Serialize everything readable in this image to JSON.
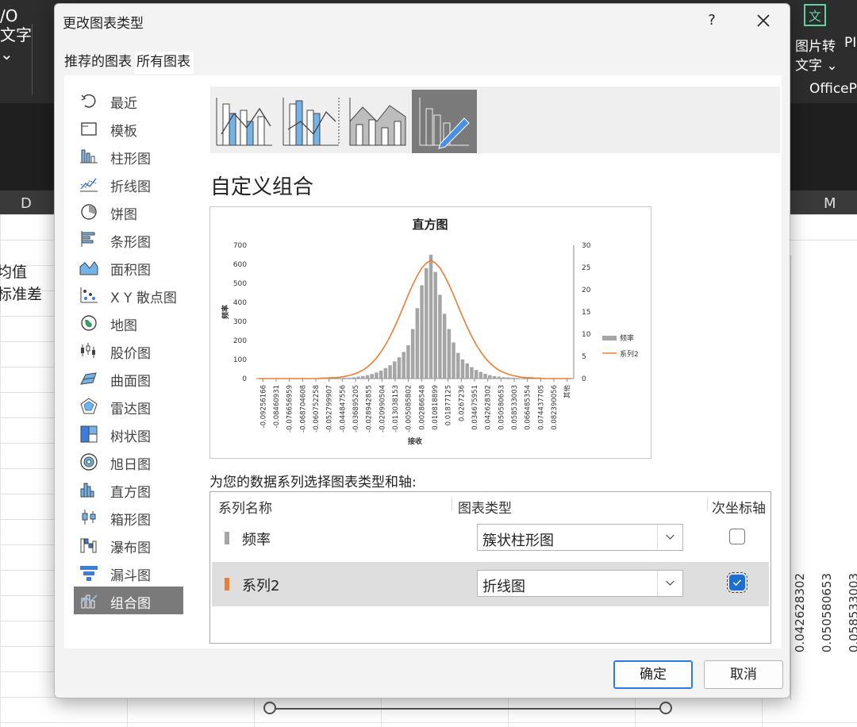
{
  "background": {
    "ribbon_left_text": "/O\n文字\n⌄",
    "ribbon_button1": "图片转",
    "ribbon_button1b": "文字 ⌄",
    "ribbon_button2": "PI",
    "ribbon_group": "OfficeP",
    "column_left": "D",
    "column_right": "M",
    "cell_text_1": "均值",
    "cell_text_2": "标准差",
    "bg_axis_labels": [
      "0.042628302",
      "0.050580653",
      "0.058533003"
    ]
  },
  "dialog": {
    "title": "更改图表类型",
    "help": "?",
    "tabs": [
      "推荐的图表",
      "所有图表"
    ],
    "active_tab": 1,
    "sidebar": [
      {
        "label": "最近",
        "icon": "recent-icon"
      },
      {
        "label": "模板",
        "icon": "template-icon"
      },
      {
        "label": "柱形图",
        "icon": "column-chart-icon"
      },
      {
        "label": "折线图",
        "icon": "line-chart-icon"
      },
      {
        "label": "饼图",
        "icon": "pie-chart-icon"
      },
      {
        "label": "条形图",
        "icon": "bar-chart-icon"
      },
      {
        "label": "面积图",
        "icon": "area-chart-icon"
      },
      {
        "label": "X Y 散点图",
        "icon": "scatter-chart-icon"
      },
      {
        "label": "地图",
        "icon": "map-chart-icon"
      },
      {
        "label": "股价图",
        "icon": "stock-chart-icon"
      },
      {
        "label": "曲面图",
        "icon": "surface-chart-icon"
      },
      {
        "label": "雷达图",
        "icon": "radar-chart-icon"
      },
      {
        "label": "树状图",
        "icon": "treemap-chart-icon"
      },
      {
        "label": "旭日图",
        "icon": "sunburst-chart-icon"
      },
      {
        "label": "直方图",
        "icon": "histogram-chart-icon"
      },
      {
        "label": "箱形图",
        "icon": "boxplot-chart-icon"
      },
      {
        "label": "瀑布图",
        "icon": "waterfall-chart-icon"
      },
      {
        "label": "漏斗图",
        "icon": "funnel-chart-icon"
      },
      {
        "label": "组合图",
        "icon": "combo-chart-icon"
      }
    ],
    "selected_index": 18,
    "section_title": "自定义组合",
    "axis_prompt": "为您的数据系列选择图表类型和轴:",
    "table_headers": {
      "series": "系列名称",
      "type": "图表类型",
      "secondary": "次坐标轴"
    },
    "series_rows": [
      {
        "name": "频率",
        "chart_type": "簇状柱形图",
        "secondary_axis": false,
        "color": "#a5a5a5"
      },
      {
        "name": "系列2",
        "chart_type": "折线图",
        "secondary_axis": true,
        "color": "#ed7d31"
      }
    ],
    "ok_label": "确定",
    "cancel_label": "取消"
  },
  "chart_data": {
    "type": "bar",
    "title": "直方图",
    "xlabel": "接收",
    "ylabel": "频率",
    "ylim": [
      0,
      700
    ],
    "y_ticks": [
      0,
      100,
      200,
      300,
      400,
      500,
      600,
      700
    ],
    "y2lim": [
      0,
      30
    ],
    "y2_ticks": [
      0,
      5,
      10,
      15,
      20,
      25,
      30
    ],
    "x_tick_labels": [
      "-0.09256166",
      "-0.08460931",
      "-0.076656959",
      "-0.068704608",
      "-0.060752258",
      "-0.052799907",
      "-0.044847556",
      "-0.036895205",
      "-0.028942855",
      "-0.020990504",
      "-0.013038153",
      "-0.005085802",
      "0.002866548",
      "0.010818899",
      "0.01877125",
      "0.0267236",
      "0.034675951",
      "0.042628302",
      "0.050580653",
      "0.058533003",
      "0.066485354",
      "0.074437705",
      "0.082390056",
      "其他"
    ],
    "series": [
      {
        "name": "频率",
        "axis": "primary",
        "color": "#a5a5a5",
        "values": [
          0,
          0,
          0,
          0,
          0,
          0,
          0,
          0,
          0,
          0,
          0,
          0,
          0,
          0,
          1,
          0,
          1,
          2,
          3,
          4,
          5,
          7,
          10,
          13,
          18,
          24,
          32,
          42,
          55,
          70,
          90,
          112,
          140,
          175,
          260,
          370,
          490,
          580,
          650,
          560,
          440,
          340,
          260,
          190,
          135,
          100,
          80,
          60,
          45,
          35,
          25,
          18,
          13,
          10,
          7,
          6,
          5,
          3,
          2,
          1,
          1,
          1,
          0,
          0,
          0,
          0,
          0,
          0,
          0,
          0
        ]
      },
      {
        "name": "系列2",
        "axis": "secondary",
        "type": "line",
        "color": "#ed7d31",
        "values": [
          0,
          0,
          0,
          0,
          0,
          0,
          0,
          0,
          0,
          0,
          0,
          0,
          0,
          0,
          0.1,
          0.1,
          0.2,
          0.2,
          0.3,
          0.5,
          0.7,
          1.0,
          1.4,
          1.9,
          2.6,
          3.5,
          4.6,
          6.0,
          7.6,
          9.5,
          11.6,
          13.9,
          16.3,
          18.8,
          21.1,
          23.2,
          24.9,
          26.0,
          26.6,
          26.0,
          24.9,
          23.2,
          21.1,
          18.8,
          16.3,
          13.9,
          11.6,
          9.5,
          7.6,
          6.0,
          4.6,
          3.5,
          2.6,
          1.9,
          1.4,
          1.0,
          0.7,
          0.5,
          0.3,
          0.2,
          0.2,
          0.1,
          0.1,
          0,
          0,
          0,
          0,
          0,
          0,
          0
        ]
      }
    ],
    "legend": "right"
  }
}
